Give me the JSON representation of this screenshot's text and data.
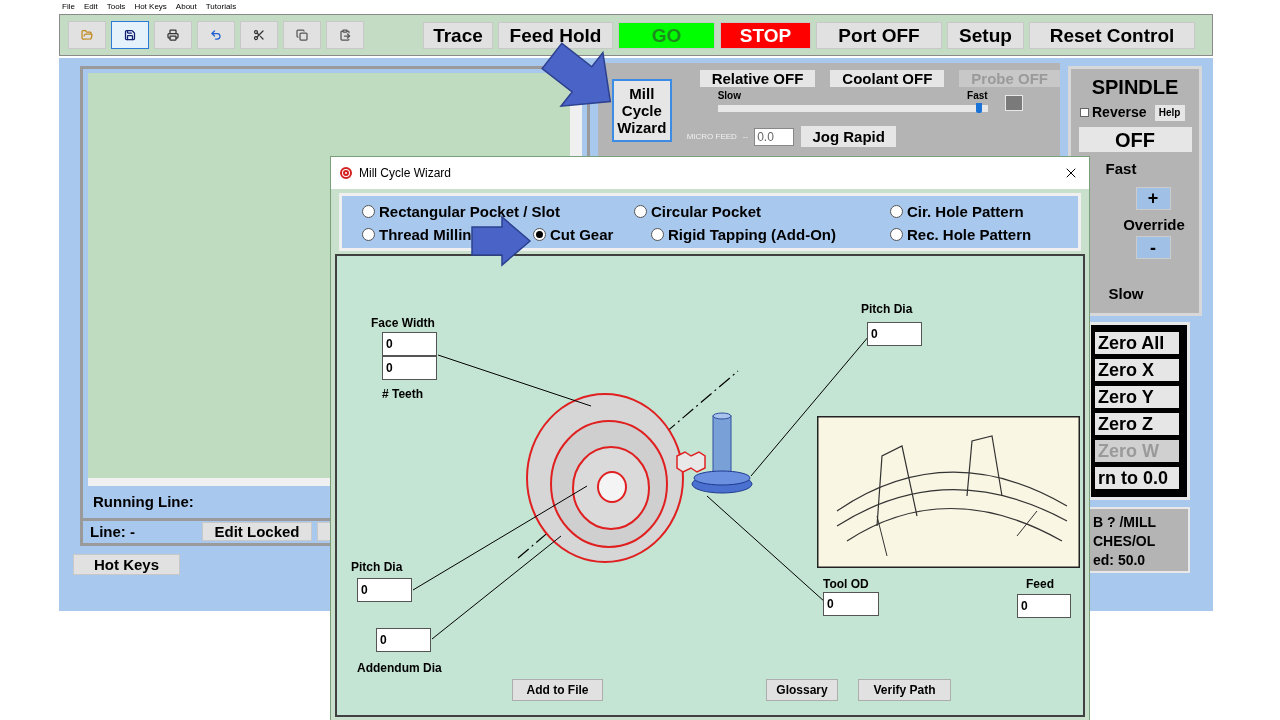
{
  "menu": [
    "File",
    "Edit",
    "Tools",
    "Hot Keys",
    "About",
    "Tutorials"
  ],
  "toolbar": {
    "icon_buttons": [
      {
        "kind": "open",
        "focused": false
      },
      {
        "kind": "save",
        "focused": true
      },
      {
        "kind": "print",
        "focused": false
      },
      {
        "kind": "undo",
        "focused": false
      },
      {
        "kind": "cut",
        "focused": false
      },
      {
        "kind": "copy",
        "focused": false
      },
      {
        "kind": "paste",
        "focused": false
      }
    ],
    "buttons": [
      {
        "label": "Trace",
        "kind": "normal"
      },
      {
        "label": "Feed Hold",
        "kind": "normal"
      },
      {
        "label": "GO",
        "kind": "go"
      },
      {
        "label": "STOP",
        "kind": "stop"
      },
      {
        "label": "Port OFF",
        "kind": "normal"
      },
      {
        "label": "Setup",
        "kind": "normal"
      },
      {
        "label": "Reset Control",
        "kind": "normal"
      }
    ]
  },
  "editor": {
    "running_line_label": "Running Line:",
    "line_label": "Line: -",
    "edit_button": "Edit Locked"
  },
  "hot_keys_button": "Hot Keys",
  "controls": {
    "wizard_button": "Mill Cycle Wizard",
    "toggles": [
      {
        "label": "Relative OFF",
        "disabled": false
      },
      {
        "label": "Coolant OFF",
        "disabled": false
      },
      {
        "label": "Probe OFF",
        "disabled": true
      }
    ],
    "speed_slider": {
      "min_label": "Slow",
      "max_label": "Fast",
      "level": 0.98
    },
    "micro_feed": {
      "label": "MICRO FEED",
      "separator": "--",
      "value": "0.0"
    },
    "jog_button": "Jog Rapid"
  },
  "spindle": {
    "title": "SPINDLE",
    "reverse": {
      "label": "Reverse",
      "checked": false
    },
    "help": "Help",
    "state": "OFF",
    "fast_label": "Fast",
    "plus": "+",
    "override_label": "Override",
    "minus": "-",
    "slow_label": "Slow"
  },
  "zero_buttons": [
    {
      "label": "Zero All",
      "disabled": false
    },
    {
      "label": "Zero X",
      "disabled": false
    },
    {
      "label": "Zero Y",
      "disabled": false
    },
    {
      "label": "Zero Z",
      "disabled": false
    },
    {
      "label": "Zero W",
      "disabled": true
    },
    {
      "label": "rn to 0.0",
      "disabled": false
    }
  ],
  "info_lines": [
    "B ? /MILL",
    "CHES/OL",
    "ed: 50.0"
  ],
  "dialog": {
    "title": "Mill Cycle Wizard",
    "operation_rows": [
      [
        {
          "label": "Rectangular Pocket / Slot",
          "selected": false
        },
        {
          "label": "Circular Pocket",
          "selected": false
        },
        {
          "label": "Cir. Hole Pattern",
          "selected": false
        }
      ],
      [
        {
          "label": "Thread Millin",
          "selected": false
        },
        {
          "label": "Cut Gear",
          "selected": true
        },
        {
          "label": "Rigid Tapping (Add-On)",
          "selected": false
        },
        {
          "label": "Rec. Hole Pattern",
          "selected": false
        }
      ]
    ],
    "fields": {
      "face_width": {
        "label": "Face Width",
        "value": "0"
      },
      "teeth": {
        "label": "# Teeth",
        "value": "0"
      },
      "pitch_dia_top": {
        "label": "Pitch Dia",
        "value": "0"
      },
      "pitch_dia_bottom": {
        "label": "Pitch Dia",
        "value": "0"
      },
      "addendum_dia": {
        "label": "Addendum Dia",
        "value": "0"
      },
      "tool_od": {
        "label": "Tool OD",
        "value": "0"
      },
      "feed": {
        "label": "Feed",
        "value": "0"
      }
    },
    "buttons": [
      "Add to File",
      "Glossary",
      "Verify Path"
    ]
  }
}
